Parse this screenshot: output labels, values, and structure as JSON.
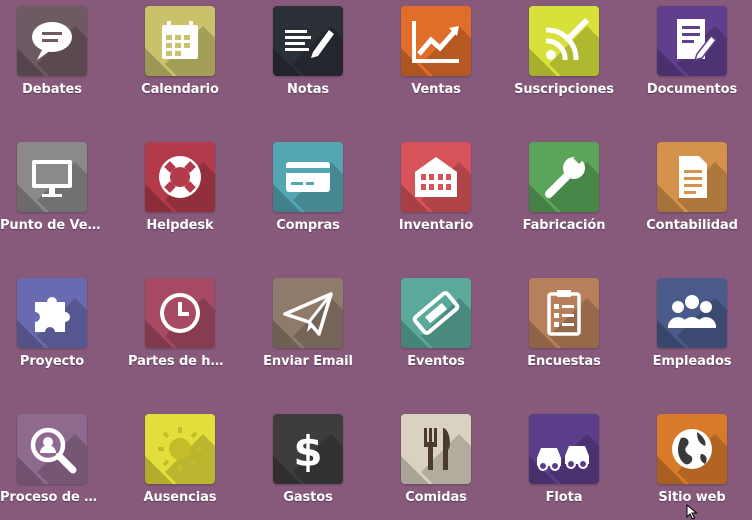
{
  "apps": [
    {
      "id": "debates",
      "label": "Debates",
      "icon": "chat-bubble-icon",
      "color": "#6e5a63"
    },
    {
      "id": "calendario",
      "label": "Calendario",
      "icon": "calendar-icon",
      "color": "#c9c26b"
    },
    {
      "id": "notas",
      "label": "Notas",
      "icon": "notes-pen-icon",
      "color": "#2b2f36"
    },
    {
      "id": "ventas",
      "label": "Ventas",
      "icon": "line-chart-icon",
      "color": "#e06d2a"
    },
    {
      "id": "suscripciones",
      "label": "Suscripciones",
      "icon": "rss-feed-icon",
      "color": "#d6e23a"
    },
    {
      "id": "documentos",
      "label": "Documentos",
      "icon": "document-edit-icon",
      "color": "#5f3f8e"
    },
    {
      "id": "punto-de-venta",
      "label": "Punto de Ven…",
      "icon": "monitor-icon",
      "color": "#8a8a8a"
    },
    {
      "id": "helpdesk",
      "label": "Helpdesk",
      "icon": "lifebuoy-icon",
      "color": "#b33a4a"
    },
    {
      "id": "compras",
      "label": "Compras",
      "icon": "credit-card-icon",
      "color": "#55a6b3"
    },
    {
      "id": "inventario",
      "label": "Inventario",
      "icon": "warehouse-icon",
      "color": "#d7535a"
    },
    {
      "id": "fabricacion",
      "label": "Fabricación",
      "icon": "wrench-icon",
      "color": "#5aa55a"
    },
    {
      "id": "contabilidad",
      "label": "Contabilidad",
      "icon": "invoice-icon",
      "color": "#d5924a"
    },
    {
      "id": "proyecto",
      "label": "Proyecto",
      "icon": "puzzle-piece-icon",
      "color": "#6a6ab0"
    },
    {
      "id": "partes-de-horas",
      "label": "Partes de hor…",
      "icon": "clock-icon",
      "color": "#a64a63"
    },
    {
      "id": "enviar-email",
      "label": "Enviar Email",
      "icon": "paper-plane-icon",
      "color": "#8f7b6c"
    },
    {
      "id": "eventos",
      "label": "Eventos",
      "icon": "ticket-icon",
      "color": "#5aa99a"
    },
    {
      "id": "encuestas",
      "label": "Encuestas",
      "icon": "clipboard-checklist-icon",
      "color": "#b7805a"
    },
    {
      "id": "empleados",
      "label": "Empleados",
      "icon": "people-group-icon",
      "color": "#4a5a8a"
    },
    {
      "id": "proceso-de-seleccion",
      "label": "Proceso de S…",
      "icon": "magnifier-person-icon",
      "color": "#8f6a8f"
    },
    {
      "id": "ausencias",
      "label": "Ausencias",
      "icon": "sun-icon",
      "color": "#e3df3a"
    },
    {
      "id": "gastos",
      "label": "Gastos",
      "icon": "dollar-sign-icon",
      "color": "#3d3d3d"
    },
    {
      "id": "comidas",
      "label": "Comidas",
      "icon": "fork-knife-icon",
      "color": "#d9d2c0"
    },
    {
      "id": "flota",
      "label": "Flota",
      "icon": "cars-icon",
      "color": "#5b3e8a"
    },
    {
      "id": "sitio-web",
      "label": "Sitio web",
      "icon": "globe-icon",
      "color": "#d97a2a"
    }
  ]
}
